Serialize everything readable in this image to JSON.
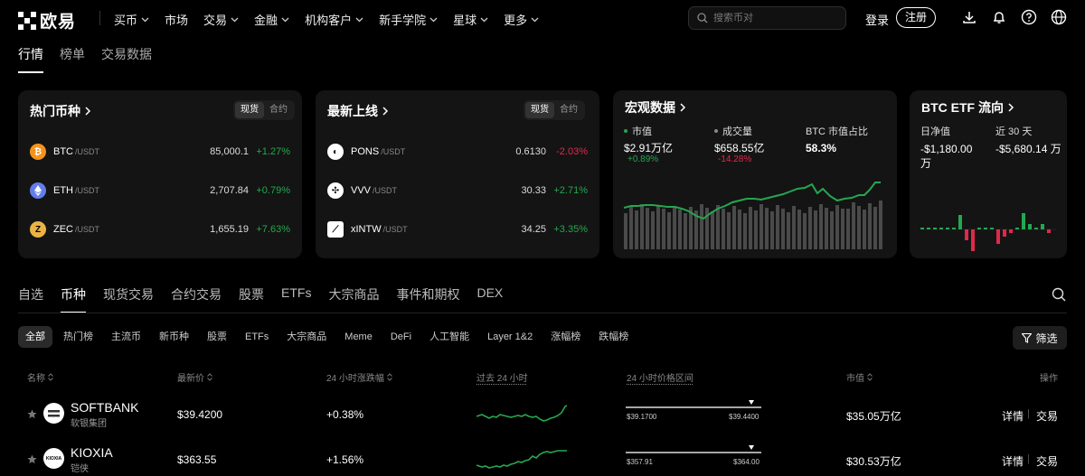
{
  "brand": {
    "name": "欧易"
  },
  "nav": {
    "items": [
      "买币",
      "市场",
      "交易",
      "金融",
      "机构客户",
      "新手学院",
      "星球",
      "更多"
    ],
    "dropdown": [
      true,
      false,
      true,
      true,
      true,
      true,
      true,
      true
    ],
    "search_placeholder": "搜索币对",
    "login": "登录",
    "register": "注册"
  },
  "subtabs": [
    "行情",
    "榜单",
    "交易数据"
  ],
  "hot": {
    "title": "热门币种",
    "seg": [
      "现货",
      "合约"
    ],
    "rows": [
      {
        "sym": "BTC",
        "quote": "/USDT",
        "price": "85,000.1",
        "chg": "+1.27%",
        "dir": "up"
      },
      {
        "sym": "ETH",
        "quote": "/USDT",
        "price": "2,707.84",
        "chg": "+0.79%",
        "dir": "up"
      },
      {
        "sym": "ZEC",
        "quote": "/USDT",
        "price": "1,655.19",
        "chg": "+7.63%",
        "dir": "up"
      }
    ]
  },
  "newlist": {
    "title": "最新上线",
    "seg": [
      "现货",
      "合约"
    ],
    "rows": [
      {
        "sym": "PONS",
        "quote": "/USDT",
        "price": "0.6130",
        "chg": "-2.03%",
        "dir": "down"
      },
      {
        "sym": "VVV",
        "quote": "/USDT",
        "price": "30.33",
        "chg": "+2.71%",
        "dir": "up"
      },
      {
        "sym": "xINTW",
        "quote": "/USDT",
        "price": "34.25",
        "chg": "+3.35%",
        "dir": "up"
      }
    ]
  },
  "macro": {
    "title": "宏观数据",
    "mcap_label": "市值",
    "mcap_value": "$2.91万亿",
    "mcap_change": "+0.89%",
    "vol_label": "成交量",
    "vol_value": "$658.55亿",
    "vol_change": "-14.28%",
    "dom_label": "BTC 市值占比",
    "dom_value": "58.3%"
  },
  "etf": {
    "title": "BTC ETF 流向",
    "daily_label": "日净值",
    "daily_value": "-$1,180.00 万",
    "month_label": "近 30 天",
    "month_value": "-$5,680.14 万"
  },
  "categories": [
    "自选",
    "币种",
    "现货交易",
    "合约交易",
    "股票",
    "ETFs",
    "大宗商品",
    "事件和期权",
    "DEX"
  ],
  "filters": [
    "全部",
    "热门榜",
    "主流币",
    "新币种",
    "股票",
    "ETFs",
    "大宗商品",
    "Meme",
    "DeFi",
    "人工智能",
    "Layer 1&2",
    "涨幅榜",
    "跌幅榜"
  ],
  "filter_button": "筛选",
  "table": {
    "headers": {
      "name": "名称",
      "price": "最新价",
      "change": "24 小时涨跌幅",
      "spark": "过去 24 小时",
      "range": "24 小时价格区间",
      "mcap": "市值",
      "action": "操作"
    },
    "rows": [
      {
        "name": "SOFTBANK",
        "sub": "软银集团",
        "price": "$39.4200",
        "change": "+0.38%",
        "low": "$39.1700",
        "high": "$39.4400",
        "mcap": "$35.05万亿",
        "detail": "详情",
        "trade": "交易",
        "logo_text": ""
      },
      {
        "name": "KIOXIA",
        "sub": "铠侠",
        "price": "$363.55",
        "change": "+1.56%",
        "low": "$357.91",
        "high": "$364.00",
        "mcap": "$30.53万亿",
        "detail": "详情",
        "trade": "交易",
        "logo_text": "KIOXIA"
      }
    ]
  },
  "colors": {
    "up": "#25a750",
    "down": "#e0294a",
    "card": "#141414",
    "btc": "#f7931a",
    "eth": "#627eea",
    "zec": "#ecb244"
  }
}
